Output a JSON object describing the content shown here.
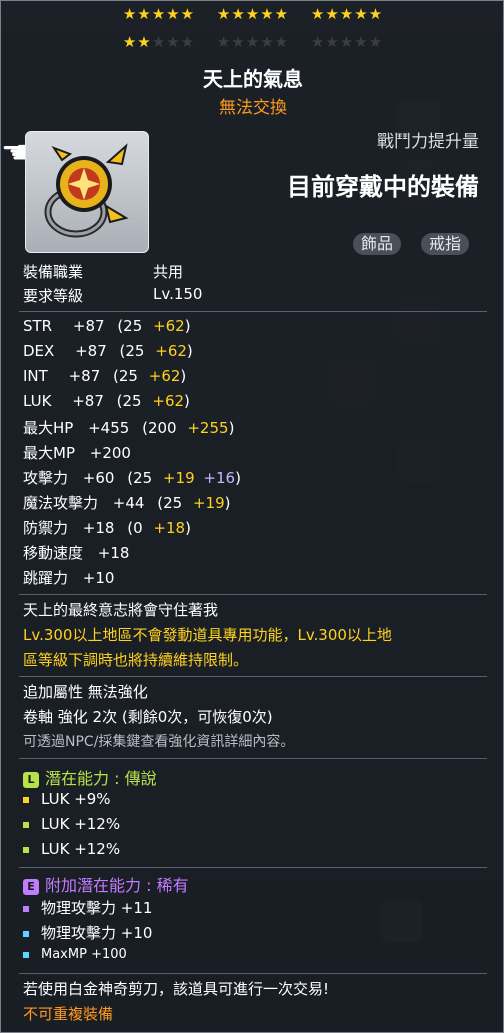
{
  "stars": {
    "total": 15,
    "filled": 17,
    "row1": [
      "★★★★★",
      "★★★★★",
      "★★★★★"
    ],
    "row2_filled": "★★",
    "row2_empty1": "★★★",
    "row2_group2": "★★★★★",
    "row2_group3": "★★★★★"
  },
  "item": {
    "name": "天上的氣息",
    "trade_status": "無法交換",
    "cp_label": "戰鬥力提升量",
    "cp_value": "目前穿戴中的裝備",
    "tags": [
      "飾品",
      "戒指"
    ],
    "job_label": "裝備職業",
    "job_value": "共用",
    "level_label": "要求等級",
    "level_value": "Lv.150"
  },
  "stats": [
    {
      "name": "STR",
      "total": "+87",
      "base": "(25",
      "bonus": "+62",
      "close": ")"
    },
    {
      "name": "DEX",
      "total": "+87",
      "base": "(25",
      "bonus": "+62",
      "close": ")"
    },
    {
      "name": "INT",
      "total": "+87",
      "base": "(25",
      "bonus": "+62",
      "close": ")"
    },
    {
      "name": "LUK",
      "total": "+87",
      "base": "(25",
      "bonus": "+62",
      "close": ")"
    },
    {
      "name": "最大HP",
      "total": "+455",
      "base": "(200",
      "bonus": "+255",
      "close": ")"
    },
    {
      "name": "最大MP",
      "total": "+200"
    },
    {
      "name": "攻擊力",
      "total": "+60",
      "base": "(25",
      "bonus": "+19",
      "bonus2": "+16",
      "close": ")"
    },
    {
      "name": "魔法攻擊力",
      "total": "+44",
      "base": "(25",
      "bonus": "+19",
      "close": ")"
    },
    {
      "name": "防禦力",
      "total": "+18",
      "base": "(0",
      "bonus": "+18",
      "close": ")"
    },
    {
      "name": "移動速度",
      "total": "+18"
    },
    {
      "name": "跳躍力",
      "total": "+10"
    }
  ],
  "description": {
    "flavor": "天上的最終意志將會守住著我",
    "line1": "Lv.300以上地區不會發動道具專用功能，Lv.300以上地",
    "line2": "區等級下調時也將持續維持限制。"
  },
  "extra": {
    "attr": "追加屬性 無法強化",
    "scroll": "卷軸 強化 2次 (剩餘0次，可恢復0次)",
    "hint": "可透過NPC/採集鍵查看強化資訊詳細內容。"
  },
  "potential": {
    "badge": "L",
    "title": "潛在能力 : 傳說",
    "lines": [
      "LUK +9%",
      "LUK +12%",
      "LUK +12%"
    ]
  },
  "additional": {
    "badge": "E",
    "title": "附加潛在能力 : 稀有",
    "lines": [
      "物理攻擊力 +11",
      "物理攻擊力 +10",
      "MaxMP +100"
    ]
  },
  "footer": {
    "scissors": "若使用白金神奇剪刀，該道具可進行一次交易!",
    "unique": "不可重複裝備"
  },
  "colors": {
    "star": "#ffd21e",
    "legendary": "#b6e34a",
    "epic": "#c27cff",
    "rare_bullet": "#5fd3ff",
    "orange": "#ff9a1e"
  }
}
